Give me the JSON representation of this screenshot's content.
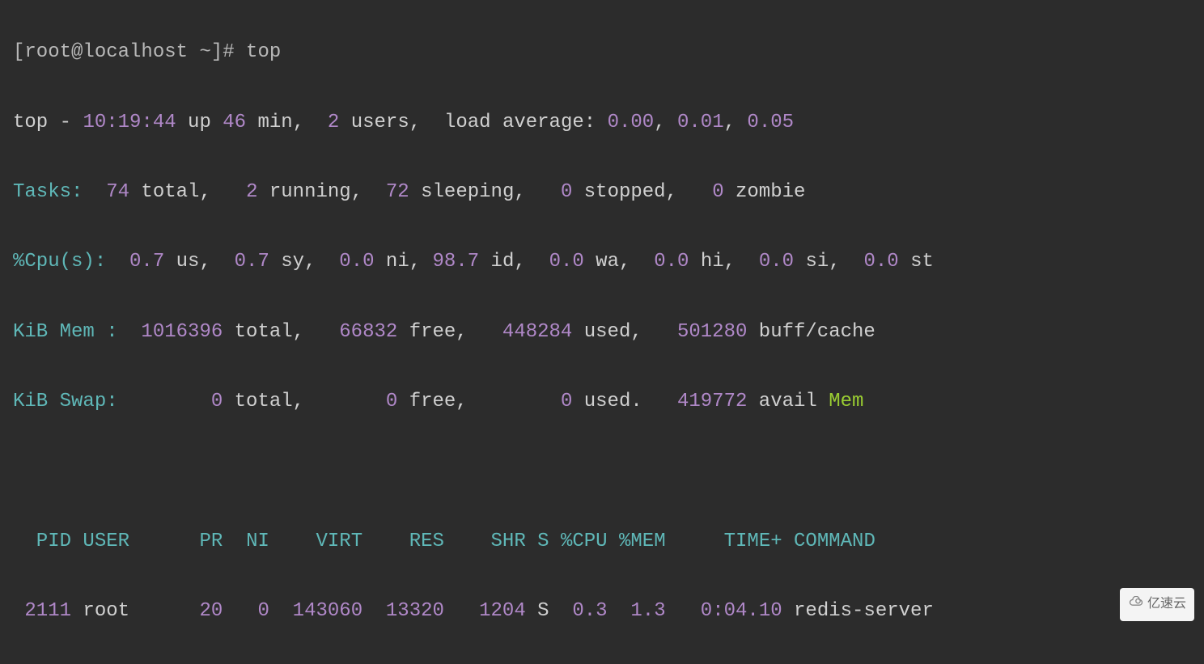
{
  "prompt": {
    "user_host": "[root@localhost ~]# ",
    "command": "top"
  },
  "summary": {
    "program": "top",
    "dash": " - ",
    "time": "10:19:44",
    "up_label": " up ",
    "uptime": "46",
    "min_label": " min,  ",
    "users": "2",
    "users_label": " users,  ",
    "load_label": "load average: ",
    "load1": "0.00",
    "comma1": ", ",
    "load2": "0.01",
    "comma2": ", ",
    "load3": "0.05"
  },
  "tasks": {
    "label": "Tasks:",
    "total_n": "  74",
    "total_l": " total,   ",
    "running_n": "2",
    "running_l": " running,  ",
    "sleeping_n": "72",
    "sleeping_l": " sleeping,   ",
    "stopped_n": "0",
    "stopped_l": " stopped,   ",
    "zombie_n": "0",
    "zombie_l": " zombie"
  },
  "cpu": {
    "label": "%Cpu(s):",
    "us_n": "  0.7",
    "us_l": " us,  ",
    "sy_n": "0.7",
    "sy_l": " sy,  ",
    "ni_n": "0.0",
    "ni_l": " ni, ",
    "id_n": "98.7",
    "id_l": " id,  ",
    "wa_n": "0.0",
    "wa_l": " wa,  ",
    "hi_n": "0.0",
    "hi_l": " hi,  ",
    "si_n": "0.0",
    "si_l": " si,  ",
    "st_n": "0.0",
    "st_l": " st"
  },
  "mem": {
    "label": "KiB Mem :",
    "total_n": "  1016396",
    "total_l": " total,   ",
    "free_n": "66832",
    "free_l": " free,   ",
    "used_n": "448284",
    "used_l": " used,   ",
    "buff_n": "501280",
    "buff_l": " buff/cache"
  },
  "swap": {
    "label": "KiB Swap:",
    "total_n": "        0",
    "total_l": " total,       ",
    "free_n": "0",
    "free_l": " free,        ",
    "used_n": "0",
    "used_l": " used.   ",
    "avail_n": "419772",
    "avail_l": " avail ",
    "mem_l": "Mem"
  },
  "header": {
    "pid": "  PID",
    "user": " USER     ",
    "pr": " PR",
    "ni": "  NI",
    "virt": "    VIRT",
    "res": "    RES",
    "shr": "    SHR",
    "s": " S",
    "cpu": " %CPU",
    "mem": " %MEM",
    "time": "     TIME+",
    "command": " COMMAND"
  },
  "rows": [
    {
      "pid": " 2111",
      "user": " root     ",
      "pr": " 20",
      "ni": "   0",
      "virt": "  143060",
      "res": "  13320",
      "shr": "   1204",
      "s": " S",
      "cpu": "  0.3",
      "mem": "  1.3",
      "time": "   0:04.10",
      "command": " redis-server"
    }
  ],
  "watermark": "亿速云"
}
